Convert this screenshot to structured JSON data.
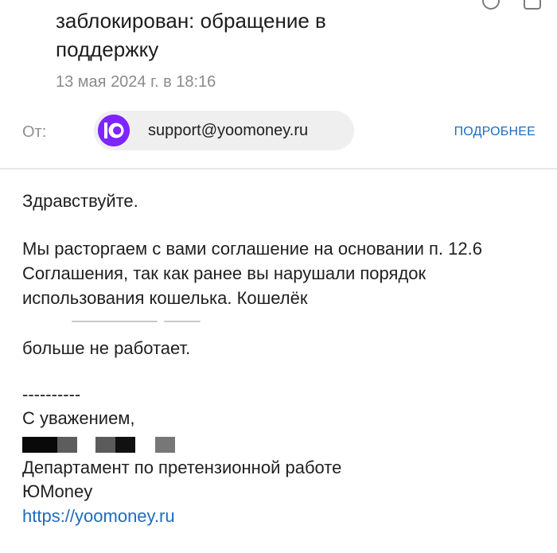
{
  "header": {
    "subject_line_1": "заблокирован: обращение в",
    "subject_line_2": "поддержку",
    "date": "13 мая 2024 г. в 18:16"
  },
  "sender": {
    "from_label": "От:",
    "email": "support@yoomoney.ru",
    "details_link": "ПОДРОБНЕЕ",
    "avatar_icon": "yoomoney-logo-icon",
    "avatar_color": "#7d24ff"
  },
  "message": {
    "greeting": "Здравствуйте.",
    "paragraph": "Мы расторгаем с вами соглашение на основании п. 12.6 Соглашения, так как ранее вы нарушали порядок использования кошелька. Кошелёк",
    "status_line": "больше не работает.",
    "separator": "----------",
    "regards": "С уважением,",
    "department": "Департамент по претензионной работе",
    "brand": "ЮMoney",
    "site_link": "https://yoomoney.ru"
  }
}
